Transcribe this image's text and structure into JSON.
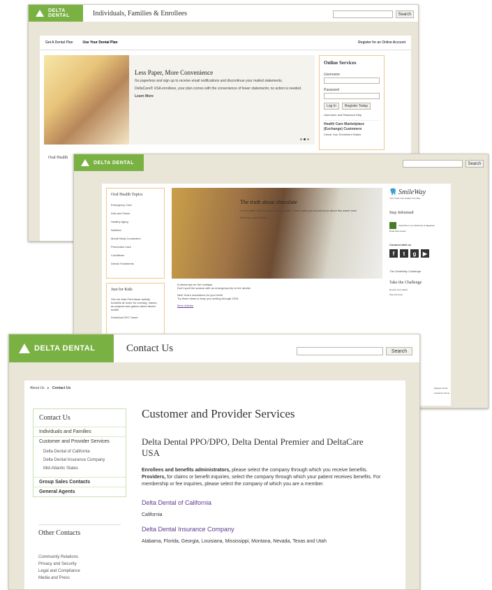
{
  "shot1": {
    "logo": "DELTA DENTAL",
    "header_title": "Individuals, Families & Enrollees",
    "search_button": "Search",
    "tabs": [
      "Get A Dental Plan",
      "Use Your Dental Plan"
    ],
    "register_link": "Register for an Online Account",
    "hero_title": "Less Paper, More Convenience",
    "hero_text": "Go paperless and sign up to receive email notifications and discontinue your mailed statements.",
    "hero_text2": "DeltaCare® USA enrollees, your plan comes with the convenience of fewer statements; no action is needed.",
    "learn_more": "Learn More",
    "online_services_title": "Online Services",
    "username_label": "Username",
    "password_label": "Password",
    "login_button": "Log In",
    "register_today": "Register Today",
    "forgot_link": "Username and Password Help",
    "marketplace_link": "Health Care Marketplace (Exchange) Customers",
    "enrollment_link": "Check Your Enrollment Status",
    "oral_health_label": "Oral Health"
  },
  "shot2": {
    "logo": "DELTA DENTAL",
    "search_button": "Search",
    "topics_title": "Oral Health Topics",
    "topics": [
      "Emergency Care",
      "Kids and Teens",
      "Healthy Aging",
      "Nutrition",
      "Mouth Body Connection",
      "Prevention Care",
      "Conditions",
      "Dental Treatments"
    ],
    "hero_title": "The truth about chocolate",
    "hero_text": "Is chocolate really that bad for your teeth? Here's what you should know about this sweet treat.",
    "read_up": "Read up, sweet tooth!",
    "news1_title": "A dental tips for the holidays",
    "news1_text": "Don't spoil the season with an emergency trip to the dentist.",
    "news2_title": "New Year's resolutions for your teeth",
    "news2_text": "Try these ideas to keep you smiling through 2016.",
    "more_articles": "More Articles",
    "kids_title": "Just for Kids",
    "kids_text": "Grin for Kids Print these activity booklets at home for coloring, mazes, an projects and games about dental health.",
    "kids_download": "Download 2017 Issue",
    "smileway_logo": "SmileWay",
    "smileway_tag": "Your Smile Your Health Your Way",
    "stay_informed": "Stay Informed",
    "subscribe_text": "Subscribe to our Webinars & Magazine",
    "read_issues": "Read back issues",
    "connect": "Connect with us",
    "social_icons": [
      "facebook-icon",
      "twitter-icon",
      "googleplus-icon",
      "youtube-icon"
    ],
    "challenge_logo": "The SmileWay Challenge",
    "take_challenge": "Take the Challenge",
    "challenge_items": [
      "Review Your Habits",
      "Stay Informed"
    ],
    "footer_links": [
      "Website Terms",
      "Insurance Terms"
    ]
  },
  "shot3": {
    "logo": "DELTA DENTAL",
    "header_title": "Contact Us",
    "search_button": "Search",
    "breadcrumb_home": "About Us",
    "breadcrumb_current": "Contact Us",
    "sidebar_title": "Contact Us",
    "sidebar_items": [
      "Individuals and Families",
      "Customer and Provider Services"
    ],
    "sub_items": [
      "Delta Dental of California",
      "Delta Dental Insurance Company",
      "Mid-Atlantic States"
    ],
    "sidebar_items2": [
      "Group Sales Contacts",
      "General Agents"
    ],
    "other_contacts_title": "Other Contacts",
    "other_contacts": [
      "Community Relations",
      "Privacy and Security",
      "Legal and Compliance",
      "Media and Press"
    ],
    "page_title": "Customer and Provider Services",
    "subtitle": "Delta Dental PPO/DPO, Delta Dental Premier and DeltaCare USA",
    "p1_bold": "Enrollees and benefits administrators,",
    "p1_rest": " please select the company through which you receive benefits.",
    "p2_bold": "Providers,",
    "p2_rest": " for claims or benefit inquiries, select the company through which your patient receives benefits. For membership or fee inquiries, please select the company of which you are a member.",
    "company1": "Delta Dental of California",
    "company1_states": "California",
    "company2": "Delta Dental Insurance Company",
    "company2_states": "Alabama, Florida, Georgia, Louisiana, Mississippi, Montana, Nevada, Texas and Utah"
  },
  "colors": {
    "brand_green": "#7ab143",
    "link_purple": "#5b3c8c",
    "background": "#e9e6d8"
  }
}
